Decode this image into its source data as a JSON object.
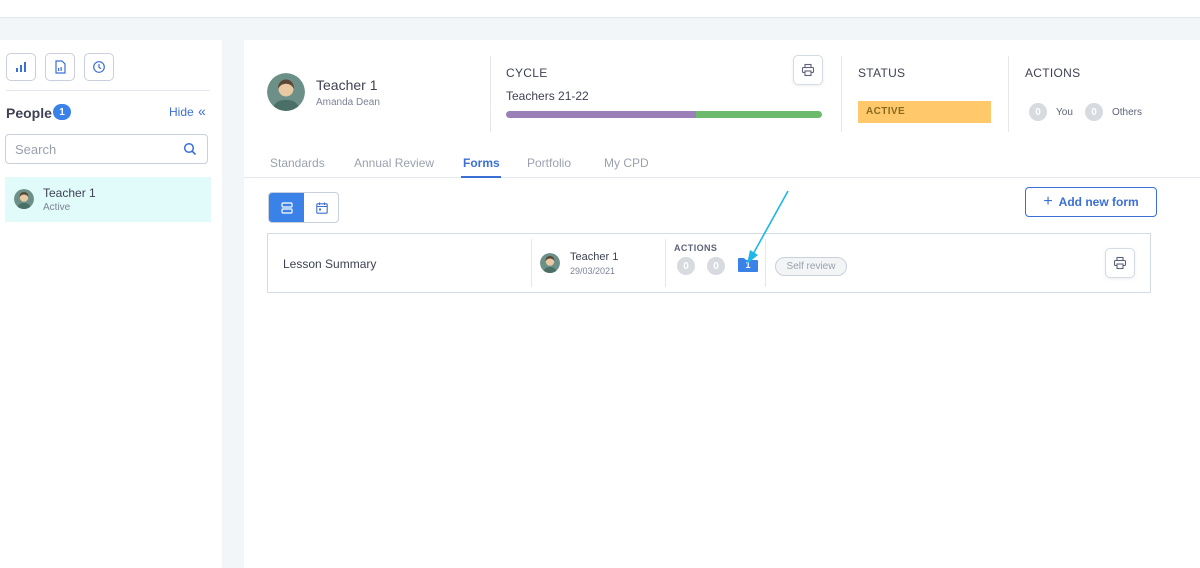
{
  "sidebar": {
    "toolbar_icons": [
      "bar-chart-icon",
      "report-icon",
      "clock-icon"
    ],
    "people_title": "People",
    "people_count": "1",
    "hide_label": "Hide",
    "hide_chevron": "«",
    "search_placeholder": "Search",
    "people": [
      {
        "name": "Teacher 1",
        "status": "Active"
      }
    ]
  },
  "header": {
    "teacher_name": "Teacher 1",
    "teacher_subname": "Amanda Dean",
    "cycle_label": "CYCLE",
    "cycle_name": "Teachers 21-22",
    "cycle_progress": {
      "segments": [
        {
          "color": "#9b7fb8",
          "fraction": 0.6
        },
        {
          "color": "#6dba6d",
          "fraction": 0.4
        }
      ]
    },
    "status_label": "STATUS",
    "status_value": "ACTIVE",
    "actions_label": "ACTIONS",
    "actions_you_count": "0",
    "actions_you_label": "You",
    "actions_others_count": "0",
    "actions_others_label": "Others"
  },
  "tabs": [
    {
      "label": "Standards",
      "active": false
    },
    {
      "label": "Annual Review",
      "active": false
    },
    {
      "label": "Forms",
      "active": true
    },
    {
      "label": "Portfolio",
      "active": false
    },
    {
      "label": "My CPD",
      "active": false
    }
  ],
  "forms_toolbar": {
    "add_label": "Add new form"
  },
  "forms": [
    {
      "title": "Lesson Summary",
      "person": "Teacher 1",
      "date": "29/03/2021",
      "actions_label": "ACTIONS",
      "count_a": "0",
      "count_b": "0",
      "folder_count": "1",
      "stage": "Self review"
    }
  ],
  "colors": {
    "accent": "#3b82e8",
    "link": "#3b6fd6",
    "status_active": "#ffc96b",
    "selected_row": "#e0fbf9",
    "annotation_arrow": "#1fb6e8"
  }
}
